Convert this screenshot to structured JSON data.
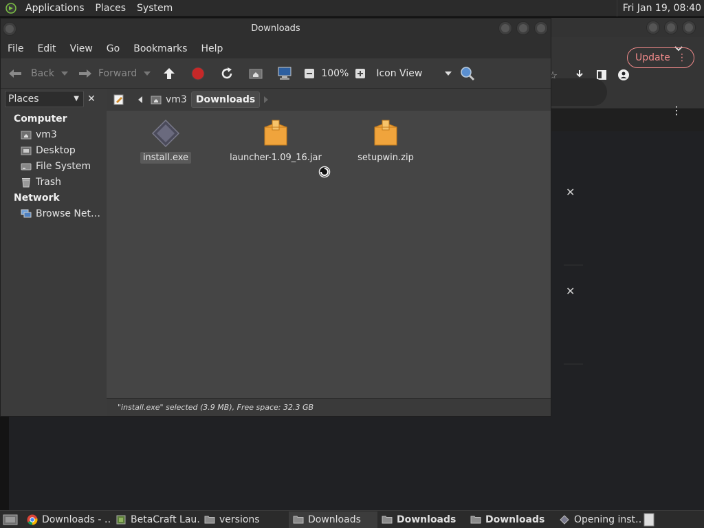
{
  "top_panel": {
    "menus": [
      "Applications",
      "Places",
      "System"
    ],
    "clock": "Fri Jan 19, 08:40"
  },
  "background_window": {
    "update_label": "Update",
    "update_menu_glyph": "⋮",
    "more_menu_glyph": "⋮",
    "close_glyph": "✕"
  },
  "window": {
    "title": "Downloads",
    "menu": [
      "File",
      "Edit",
      "View",
      "Go",
      "Bookmarks",
      "Help"
    ],
    "toolbar": {
      "back": "Back",
      "forward": "Forward",
      "zoom": "100%",
      "view_mode": "Icon View"
    },
    "path": {
      "segments": [
        "vm3",
        "Downloads"
      ]
    },
    "sidebar": {
      "selector": "Places",
      "close_glyph": "✕",
      "computer_header": "Computer",
      "computer_items": [
        {
          "label": "vm3",
          "icon": "home-folder-icon"
        },
        {
          "label": "Desktop",
          "icon": "desktop-folder-icon"
        },
        {
          "label": "File System",
          "icon": "drive-icon"
        },
        {
          "label": "Trash",
          "icon": "trash-icon"
        }
      ],
      "network_header": "Network",
      "network_items": [
        {
          "label": "Browse Net…",
          "icon": "network-icon"
        }
      ]
    },
    "files": [
      {
        "name": "install.exe",
        "icon": "executable-icon",
        "selected": true
      },
      {
        "name": "launcher-1.09_16.jar",
        "icon": "archive-icon",
        "selected": false
      },
      {
        "name": "setupwin.zip",
        "icon": "archive-icon",
        "selected": false
      }
    ],
    "status": "\"install.exe\" selected (3.9 MB), Free space: 32.3 GB"
  },
  "taskbar": {
    "tasks": [
      {
        "label": "Downloads - …",
        "icon": "chrome-icon",
        "active": false,
        "bold": false
      },
      {
        "label": "BetaCraft Lau…",
        "icon": "java-icon",
        "active": false,
        "bold": false
      },
      {
        "label": "versions",
        "icon": "folder-icon",
        "active": false,
        "bold": false
      },
      {
        "label": "Downloads",
        "icon": "folder-icon",
        "active": true,
        "bold": false
      },
      {
        "label": "Downloads",
        "icon": "folder-icon",
        "active": false,
        "bold": true
      },
      {
        "label": "Downloads",
        "icon": "folder-icon",
        "active": false,
        "bold": true
      },
      {
        "label": "Opening inst…",
        "icon": "executable-icon",
        "active": false,
        "bold": false
      }
    ]
  },
  "colors": {
    "accent_update": "#f08a8a",
    "folder": "#f0a43c",
    "panel": "#2b2b2b"
  }
}
